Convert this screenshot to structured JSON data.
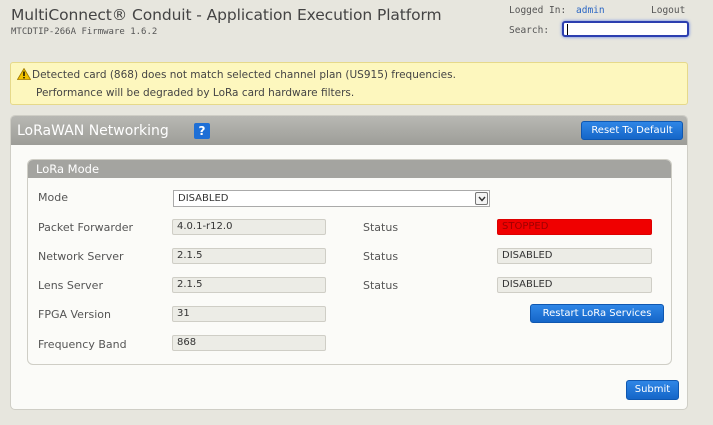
{
  "header": {
    "title": "MultiConnect® Conduit - Application Execution Platform",
    "subtitle": "MTCDTIP-266A  Firmware 1.6.2",
    "logged_in_label": "Logged In:",
    "user": "admin",
    "logout": "Logout",
    "search_label": "Search:",
    "search_value": ""
  },
  "warning": {
    "line1": "Detected card (868) does not match selected channel plan (US915) frequencies.",
    "line2": "Performance will be degraded by LoRa card hardware filters.",
    "icon": "warning-triangle-icon"
  },
  "panel": {
    "title": "LoRaWAN Networking",
    "help_icon_text": "?",
    "reset_label": "Reset To Default",
    "submit_label": "Submit",
    "accent_color": "#1e6fd6"
  },
  "lora_mode": {
    "title": "LoRa Mode",
    "mode_label": "Mode",
    "mode_value": "DISABLED",
    "packet_forwarder_label": "Packet Forwarder",
    "packet_forwarder_value": "4.0.1-r12.0",
    "packet_forwarder_status_label": "Status",
    "packet_forwarder_status": "STOPPED",
    "network_server_label": "Network Server",
    "network_server_value": "2.1.5",
    "network_server_status_label": "Status",
    "network_server_status": "DISABLED",
    "lens_server_label": "Lens Server",
    "lens_server_value": "2.1.5",
    "lens_server_status_label": "Status",
    "lens_server_status": "DISABLED",
    "fpga_label": "FPGA Version",
    "fpga_value": "31",
    "frequency_band_label": "Frequency Band",
    "frequency_band_value": "868",
    "restart_label": "Restart LoRa Services",
    "stopped_color": "#f00000"
  }
}
